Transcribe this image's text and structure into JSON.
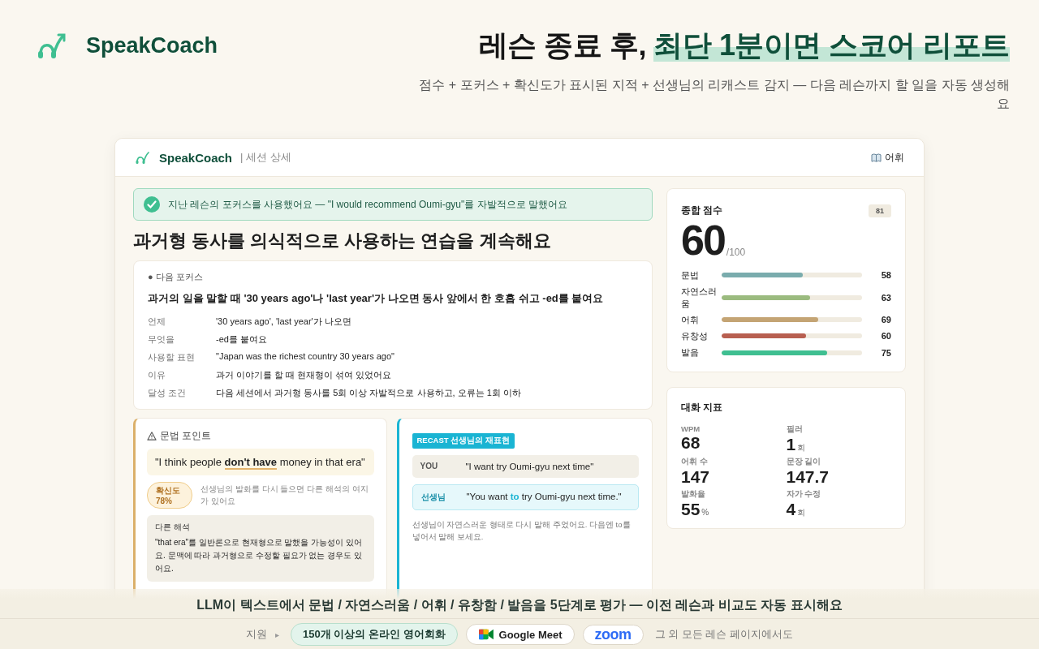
{
  "brand": {
    "name": "SpeakCoach"
  },
  "headline": {
    "lead": "레슨 종료 후, ",
    "highlight": "최단 1분이면 스코어 리포트"
  },
  "subtitle": "점수 + 포커스 + 확신도가 표시된 지적 + 선생님의 리캐스트 감지 — 다음 레슨까지 할 일을 자동 생성해요",
  "app": {
    "brand": "SpeakCoach",
    "breadcrumb": "| 세션 상세",
    "vocab_link": "어휘",
    "success_banner": "지난 레슨의 포커스를 사용했어요 — \"I would recommend Oumi-gyu\"를 자발적으로 말했어요",
    "page_title": "과거형 동사를 의식적으로 사용하는 연습을 계속해요",
    "focus": {
      "label": "● 다음 포커스",
      "heading": "과거의 일을 말할 때 **'30 years ago'**나 **'last year'**가 나오면 동사 앞에서 한 호흡 쉬고 **-ed**를 붙여요",
      "rows": [
        {
          "term": "언제",
          "value": "'30 years ago', 'last year'가 나오면"
        },
        {
          "term": "무엇을",
          "value": "-ed를 붙여요"
        },
        {
          "term": "사용할 표현",
          "value": "\"Japan was the richest country 30 years ago\""
        },
        {
          "term": "이유",
          "value": "과거 이야기를 할 때 현재형이 섞여 있었어요"
        },
        {
          "term": "달성 조건",
          "value": "다음 세션에서 과거형 동사를 5회 이상 자발적으로 사용하고, 오류는 1회 이하"
        }
      ]
    },
    "grammar": {
      "title": "문법 포인트",
      "quote": "\"I think people **don't have** money in that era\"",
      "confidence_label": "확신도",
      "confidence_value": "78%",
      "confidence_note": "선생님의 발화를 다시 들으면 다른 해석의 여지가 있어요",
      "alt_title": "다른 해석",
      "alt_text": "\"that era\"를 일반론으로 현재형으로 말했을 가능성이 있어요. 문맥에 따라 과거형으로 수정할 필요가 없는 경우도 있어요."
    },
    "recast": {
      "badge": "RECAST 선생님의 재표현",
      "lines": [
        {
          "kind": "you",
          "speaker": "YOU",
          "text": "\"I want try Oumi-gyu next time\""
        },
        {
          "kind": "teacher",
          "speaker": "선생님",
          "text": "\"You want **to** try Oumi-gyu next time.\""
        }
      ],
      "note": "선생님이 자연스러운 형태로 다시 말해 주었어요. 다음엔 to를 넣어서 말해 보세요."
    },
    "score": {
      "title": "종합 점수",
      "badge": "81",
      "value": "60",
      "max": "/100",
      "items": [
        {
          "label": "문법",
          "level": 0.58,
          "value": "58",
          "color": "#7aacad"
        },
        {
          "label": "자연스러움",
          "level": 0.63,
          "value": "63",
          "color": "#9bbb7f"
        },
        {
          "label": "어휘",
          "level": 0.69,
          "value": "69",
          "color": "#c4a474"
        },
        {
          "label": "유창성",
          "level": 0.6,
          "value": "60",
          "color": "#b85f50"
        },
        {
          "label": "발음",
          "level": 0.75,
          "value": "75",
          "color": "#3fbf91"
        }
      ]
    },
    "metrics": {
      "title": "대화 지표",
      "items": [
        {
          "label": "WPM",
          "value": "68"
        },
        {
          "label": "필러",
          "value": "1",
          "unit": "회"
        },
        {
          "label": "어휘 수",
          "value": "147"
        },
        {
          "label": "문장 길이",
          "value": "147.7"
        },
        {
          "label": "발화율",
          "value": "55",
          "unit": "%"
        },
        {
          "label": "자가 수정",
          "value": "4",
          "unit": "회"
        }
      ]
    }
  },
  "caption": "LLM이 텍스트에서 문법 / 자연스러움 / 어휘 / 유창함 / 발음을 5단계로 평가 — 이전 레슨과 비교도 자동 표시해요",
  "support": {
    "label": "지원",
    "arrow": "▸",
    "chips": [
      {
        "kind": "text",
        "label": "150개 이상의 온라인 영어회화"
      },
      {
        "kind": "meet",
        "label": "Google Meet"
      },
      {
        "kind": "zoom",
        "label": "zoom"
      }
    ],
    "note": "그 외 모든 레슨 페이지에서도"
  }
}
